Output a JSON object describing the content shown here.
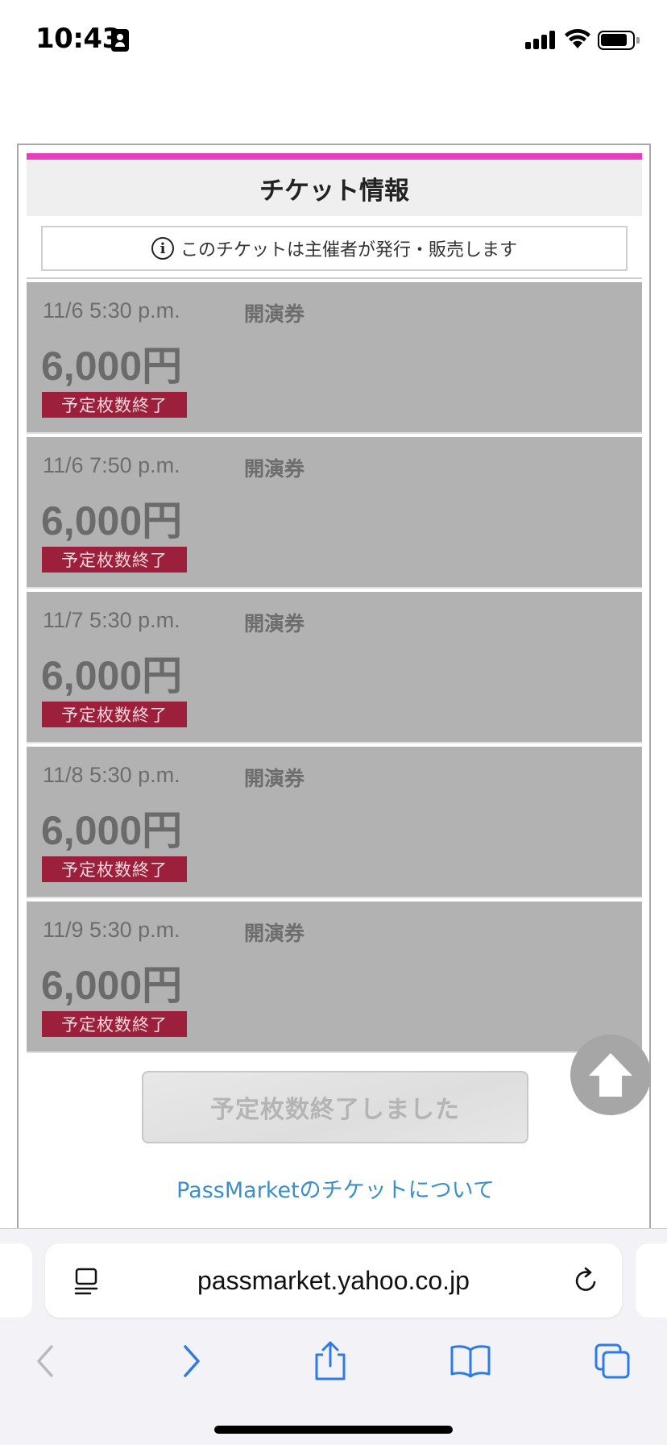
{
  "status_bar": {
    "time": "10:43",
    "icons": [
      "contact-card-icon",
      "cellular-signal-icon",
      "wifi-icon",
      "battery-icon"
    ]
  },
  "panel": {
    "header_title": "チケット情報",
    "notice_text": "このチケットは主催者が発行・販売します",
    "notice_icon": "info-icon",
    "accent_color": "#e93cbe",
    "tickets": [
      {
        "datetime": "11/6 5:30 p.m.",
        "type": "開演券",
        "price": "6,000円",
        "status": "予定枚数終了"
      },
      {
        "datetime": "11/6 7:50 p.m.",
        "type": "開演券",
        "price": "6,000円",
        "status": "予定枚数終了"
      },
      {
        "datetime": "11/7 5:30 p.m.",
        "type": "開演券",
        "price": "6,000円",
        "status": "予定枚数終了"
      },
      {
        "datetime": "11/8 5:30 p.m.",
        "type": "開演券",
        "price": "6,000円",
        "status": "予定枚数終了"
      },
      {
        "datetime": "11/9 5:30 p.m.",
        "type": "開演券",
        "price": "6,000円",
        "status": "予定枚数終了"
      }
    ],
    "ended_button_label": "予定枚数終了しました",
    "about_link": "PassMarketのチケットについて",
    "link_color": "#3a8fc9",
    "badge_color": "#9c1f3b"
  },
  "scroll_top": {
    "icon": "arrow-up-icon"
  },
  "browser": {
    "url": "passmarket.yahoo.co.jp",
    "icons": [
      "reader-icon",
      "reload-icon",
      "back-icon",
      "forward-icon",
      "share-icon",
      "bookmarks-icon",
      "tabs-icon"
    ]
  }
}
